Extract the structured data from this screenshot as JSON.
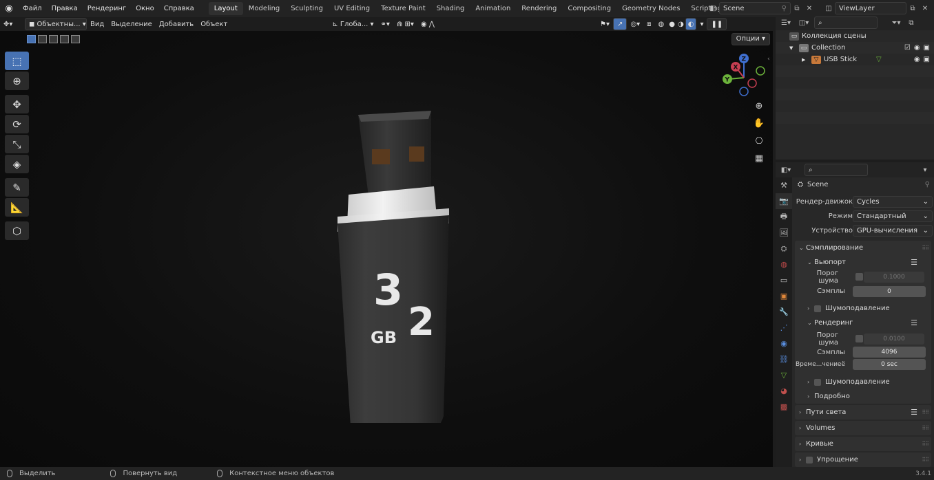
{
  "menu": [
    "Файл",
    "Правка",
    "Рендеринг",
    "Окно",
    "Справка"
  ],
  "workspaces": [
    "Layout",
    "Modeling",
    "Sculpting",
    "UV Editing",
    "Texture Paint",
    "Shading",
    "Animation",
    "Rendering",
    "Compositing",
    "Geometry Nodes",
    "Scripting"
  ],
  "active_workspace": "Layout",
  "scene_name": "Scene",
  "view_layer": "ViewLayer",
  "viewport_header": {
    "mode": "Объектны...",
    "menus": [
      "Вид",
      "Выделение",
      "Добавить",
      "Объект"
    ],
    "transform_orientation": "Глоба...",
    "options": "Опции"
  },
  "outliner": {
    "root": "Коллекция сцены",
    "collection": "Collection",
    "object": "USB Stick"
  },
  "properties": {
    "context": "Scene",
    "render_engine_label": "Рендер-движок",
    "render_engine": "Cycles",
    "mode_label": "Режим",
    "mode": "Стандартный",
    "device_label": "Устройство",
    "device": "GPU-вычисления",
    "sampling": "Сэмплирование",
    "viewport": "Вьюпорт",
    "noise_threshold_label": "Порог шума",
    "viewport_noise_threshold": "0.1000",
    "samples_label": "Сэмплы",
    "viewport_samples": "0",
    "denoise": "Шумоподавление",
    "render": "Рендеринг",
    "render_noise_threshold": "0.0100",
    "render_samples": "4096",
    "time_limit_label": "Време...чениеё",
    "time_limit": "0 sec",
    "advanced": "Подробно",
    "light_paths": "Пути света",
    "volumes": "Volumes",
    "curves": "Кривые",
    "simplify": "Упрощение"
  },
  "usb_label": {
    "big": "3",
    "small": "2",
    "unit": "GB"
  },
  "gizmo": {
    "x": "X",
    "y": "Y",
    "z": "Z"
  },
  "statusbar": {
    "select": "Выделить",
    "rotate": "Повернуть вид",
    "context_menu": "Контекстное меню объектов",
    "version": "3.4.1"
  },
  "colors": {
    "accent": "#4772b3",
    "bg": "#1d1d1d",
    "panel": "#303030"
  }
}
